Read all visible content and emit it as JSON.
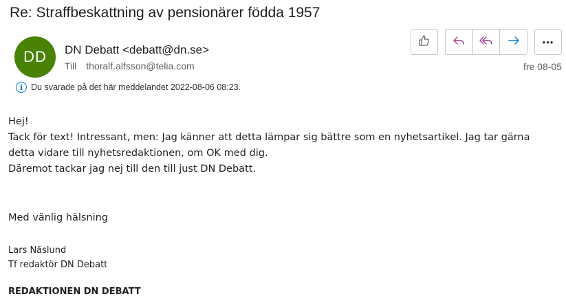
{
  "message": {
    "subject": "Re: Straffbeskattning av pensionärer födda 1957",
    "avatar_initials": "DD",
    "avatar_color": "#498205",
    "sender": "DN Debatt <debatt@dn.se>",
    "to_label": "Till",
    "to_address": "thoralf.alfsson@telia.com",
    "date": "fre 08-05",
    "info_notice": "Du svarade på det här meddelandet 2022-08-06 08:23."
  },
  "actions": {
    "like_icon": "thumbs-up-icon",
    "reply_icon": "reply-icon",
    "reply_all_icon": "reply-all-icon",
    "forward_icon": "forward-icon",
    "more_icon": "more-icon",
    "more_label": "•••",
    "accent_color": "#a4378a",
    "forward_color": "#0078d4"
  },
  "body": {
    "lines": [
      "Hej!",
      "Tack för text! Intressant, men: Jag känner att detta lämpar sig bättre som en nyhetsartikel. Jag tar gärna",
      "detta vidare till nyhetsredaktionen, om OK med dig.",
      "Däremot tackar jag nej till den till just DN Debatt."
    ],
    "closing": "Med vänlig hälsning",
    "signature_name": "Lars Näslund",
    "signature_title": "Tf redaktör DN Debatt",
    "signature_department": "REDAKTIONEN DN DEBATT"
  }
}
